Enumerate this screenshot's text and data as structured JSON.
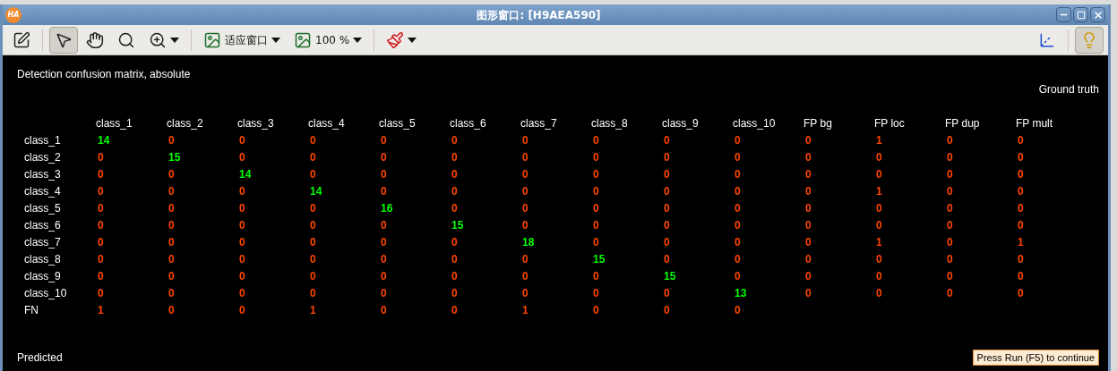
{
  "window": {
    "logo": "HA",
    "title": "图形窗口: [H9AEA590]"
  },
  "toolbar": [
    {
      "kind": "edit",
      "selected": false
    },
    {
      "kind": "pointer",
      "selected": true
    },
    {
      "kind": "pan",
      "selected": false
    },
    {
      "kind": "magnify",
      "selected": false
    },
    {
      "kind": "zoom",
      "selected": false,
      "menu": true
    },
    {
      "kind": "fit",
      "selected": false,
      "menu": true,
      "label": "适应窗口"
    },
    {
      "kind": "scale",
      "selected": false,
      "menu": true,
      "label": "100 %"
    },
    {
      "kind": "paint",
      "selected": false,
      "menu": true
    },
    {
      "kind": "axes",
      "selected": false
    },
    {
      "kind": "light",
      "selected": true
    }
  ],
  "canvas": {
    "title": "Detection confusion matrix, absolute",
    "column_axis": "Ground truth",
    "row_axis": "Predicted",
    "prompt": "Press Run (F5) to continue",
    "columns": [
      "class_1",
      "class_2",
      "class_3",
      "class_4",
      "class_5",
      "class_6",
      "class_7",
      "class_8",
      "class_9",
      "class_10",
      "FP bg",
      "FP loc",
      "FP dup",
      "FP mult"
    ],
    "rows": [
      {
        "label": "class_1",
        "cells": [
          {
            "value": "14",
            "color": "#00ff00"
          },
          {
            "value": "0",
            "color": "#ff4500"
          },
          {
            "value": "0",
            "color": "#ff4500"
          },
          {
            "value": "0",
            "color": "#ff4500"
          },
          {
            "value": "0",
            "color": "#ff4500"
          },
          {
            "value": "0",
            "color": "#ff4500"
          },
          {
            "value": "0",
            "color": "#ff4500"
          },
          {
            "value": "0",
            "color": "#ff4500"
          },
          {
            "value": "0",
            "color": "#ff4500"
          },
          {
            "value": "0",
            "color": "#ff4500"
          },
          {
            "value": "0",
            "color": "#ff4500"
          },
          {
            "value": "1",
            "color": "#ff4500"
          },
          {
            "value": "0",
            "color": "#ff4500"
          },
          {
            "value": "0",
            "color": "#ff4500"
          }
        ]
      },
      {
        "label": "class_2",
        "cells": [
          {
            "value": "0",
            "color": "#ff4500"
          },
          {
            "value": "15",
            "color": "#00ff00"
          },
          {
            "value": "0",
            "color": "#ff4500"
          },
          {
            "value": "0",
            "color": "#ff4500"
          },
          {
            "value": "0",
            "color": "#ff4500"
          },
          {
            "value": "0",
            "color": "#ff4500"
          },
          {
            "value": "0",
            "color": "#ff4500"
          },
          {
            "value": "0",
            "color": "#ff4500"
          },
          {
            "value": "0",
            "color": "#ff4500"
          },
          {
            "value": "0",
            "color": "#ff4500"
          },
          {
            "value": "0",
            "color": "#ff4500"
          },
          {
            "value": "0",
            "color": "#ff4500"
          },
          {
            "value": "0",
            "color": "#ff4500"
          },
          {
            "value": "0",
            "color": "#ff4500"
          }
        ]
      },
      {
        "label": "class_3",
        "cells": [
          {
            "value": "0",
            "color": "#ff4500"
          },
          {
            "value": "0",
            "color": "#ff4500"
          },
          {
            "value": "14",
            "color": "#00ff00"
          },
          {
            "value": "0",
            "color": "#ff4500"
          },
          {
            "value": "0",
            "color": "#ff4500"
          },
          {
            "value": "0",
            "color": "#ff4500"
          },
          {
            "value": "0",
            "color": "#ff4500"
          },
          {
            "value": "0",
            "color": "#ff4500"
          },
          {
            "value": "0",
            "color": "#ff4500"
          },
          {
            "value": "0",
            "color": "#ff4500"
          },
          {
            "value": "0",
            "color": "#ff4500"
          },
          {
            "value": "0",
            "color": "#ff4500"
          },
          {
            "value": "0",
            "color": "#ff4500"
          },
          {
            "value": "0",
            "color": "#ff4500"
          }
        ]
      },
      {
        "label": "class_4",
        "cells": [
          {
            "value": "0",
            "color": "#ff4500"
          },
          {
            "value": "0",
            "color": "#ff4500"
          },
          {
            "value": "0",
            "color": "#ff4500"
          },
          {
            "value": "14",
            "color": "#00ff00"
          },
          {
            "value": "0",
            "color": "#ff4500"
          },
          {
            "value": "0",
            "color": "#ff4500"
          },
          {
            "value": "0",
            "color": "#ff4500"
          },
          {
            "value": "0",
            "color": "#ff4500"
          },
          {
            "value": "0",
            "color": "#ff4500"
          },
          {
            "value": "0",
            "color": "#ff4500"
          },
          {
            "value": "0",
            "color": "#ff4500"
          },
          {
            "value": "1",
            "color": "#ff4500"
          },
          {
            "value": "0",
            "color": "#ff4500"
          },
          {
            "value": "0",
            "color": "#ff4500"
          }
        ]
      },
      {
        "label": "class_5",
        "cells": [
          {
            "value": "0",
            "color": "#ff4500"
          },
          {
            "value": "0",
            "color": "#ff4500"
          },
          {
            "value": "0",
            "color": "#ff4500"
          },
          {
            "value": "0",
            "color": "#ff4500"
          },
          {
            "value": "16",
            "color": "#00ff00"
          },
          {
            "value": "0",
            "color": "#ff4500"
          },
          {
            "value": "0",
            "color": "#ff4500"
          },
          {
            "value": "0",
            "color": "#ff4500"
          },
          {
            "value": "0",
            "color": "#ff4500"
          },
          {
            "value": "0",
            "color": "#ff4500"
          },
          {
            "value": "0",
            "color": "#ff4500"
          },
          {
            "value": "0",
            "color": "#ff4500"
          },
          {
            "value": "0",
            "color": "#ff4500"
          },
          {
            "value": "0",
            "color": "#ff4500"
          }
        ]
      },
      {
        "label": "class_6",
        "cells": [
          {
            "value": "0",
            "color": "#ff4500"
          },
          {
            "value": "0",
            "color": "#ff4500"
          },
          {
            "value": "0",
            "color": "#ff4500"
          },
          {
            "value": "0",
            "color": "#ff4500"
          },
          {
            "value": "0",
            "color": "#ff4500"
          },
          {
            "value": "15",
            "color": "#00ff00"
          },
          {
            "value": "0",
            "color": "#ff4500"
          },
          {
            "value": "0",
            "color": "#ff4500"
          },
          {
            "value": "0",
            "color": "#ff4500"
          },
          {
            "value": "0",
            "color": "#ff4500"
          },
          {
            "value": "0",
            "color": "#ff4500"
          },
          {
            "value": "0",
            "color": "#ff4500"
          },
          {
            "value": "0",
            "color": "#ff4500"
          },
          {
            "value": "0",
            "color": "#ff4500"
          }
        ]
      },
      {
        "label": "class_7",
        "cells": [
          {
            "value": "0",
            "color": "#ff4500"
          },
          {
            "value": "0",
            "color": "#ff4500"
          },
          {
            "value": "0",
            "color": "#ff4500"
          },
          {
            "value": "0",
            "color": "#ff4500"
          },
          {
            "value": "0",
            "color": "#ff4500"
          },
          {
            "value": "0",
            "color": "#ff4500"
          },
          {
            "value": "18",
            "color": "#00ff00"
          },
          {
            "value": "0",
            "color": "#ff4500"
          },
          {
            "value": "0",
            "color": "#ff4500"
          },
          {
            "value": "0",
            "color": "#ff4500"
          },
          {
            "value": "0",
            "color": "#ff4500"
          },
          {
            "value": "1",
            "color": "#ff4500"
          },
          {
            "value": "0",
            "color": "#ff4500"
          },
          {
            "value": "1",
            "color": "#ff4500"
          }
        ]
      },
      {
        "label": "class_8",
        "cells": [
          {
            "value": "0",
            "color": "#ff4500"
          },
          {
            "value": "0",
            "color": "#ff4500"
          },
          {
            "value": "0",
            "color": "#ff4500"
          },
          {
            "value": "0",
            "color": "#ff4500"
          },
          {
            "value": "0",
            "color": "#ff4500"
          },
          {
            "value": "0",
            "color": "#ff4500"
          },
          {
            "value": "0",
            "color": "#ff4500"
          },
          {
            "value": "15",
            "color": "#00ff00"
          },
          {
            "value": "0",
            "color": "#ff4500"
          },
          {
            "value": "0",
            "color": "#ff4500"
          },
          {
            "value": "0",
            "color": "#ff4500"
          },
          {
            "value": "0",
            "color": "#ff4500"
          },
          {
            "value": "0",
            "color": "#ff4500"
          },
          {
            "value": "0",
            "color": "#ff4500"
          }
        ]
      },
      {
        "label": "class_9",
        "cells": [
          {
            "value": "0",
            "color": "#ff4500"
          },
          {
            "value": "0",
            "color": "#ff4500"
          },
          {
            "value": "0",
            "color": "#ff4500"
          },
          {
            "value": "0",
            "color": "#ff4500"
          },
          {
            "value": "0",
            "color": "#ff4500"
          },
          {
            "value": "0",
            "color": "#ff4500"
          },
          {
            "value": "0",
            "color": "#ff4500"
          },
          {
            "value": "0",
            "color": "#ff4500"
          },
          {
            "value": "15",
            "color": "#00ff00"
          },
          {
            "value": "0",
            "color": "#ff4500"
          },
          {
            "value": "0",
            "color": "#ff4500"
          },
          {
            "value": "0",
            "color": "#ff4500"
          },
          {
            "value": "0",
            "color": "#ff4500"
          },
          {
            "value": "0",
            "color": "#ff4500"
          }
        ]
      },
      {
        "label": "class_10",
        "cells": [
          {
            "value": "0",
            "color": "#ff4500"
          },
          {
            "value": "0",
            "color": "#ff4500"
          },
          {
            "value": "0",
            "color": "#ff4500"
          },
          {
            "value": "0",
            "color": "#ff4500"
          },
          {
            "value": "0",
            "color": "#ff4500"
          },
          {
            "value": "0",
            "color": "#ff4500"
          },
          {
            "value": "0",
            "color": "#ff4500"
          },
          {
            "value": "0",
            "color": "#ff4500"
          },
          {
            "value": "0",
            "color": "#ff4500"
          },
          {
            "value": "13",
            "color": "#00ff00"
          },
          {
            "value": "0",
            "color": "#ff4500"
          },
          {
            "value": "0",
            "color": "#ff4500"
          },
          {
            "value": "0",
            "color": "#ff4500"
          },
          {
            "value": "0",
            "color": "#ff4500"
          }
        ]
      },
      {
        "label": "FN",
        "cells": [
          {
            "value": "1",
            "color": "#ff4500"
          },
          {
            "value": "0",
            "color": "#ff4500"
          },
          {
            "value": "0",
            "color": "#ff4500"
          },
          {
            "value": "1",
            "color": "#ff4500"
          },
          {
            "value": "0",
            "color": "#ff4500"
          },
          {
            "value": "0",
            "color": "#ff4500"
          },
          {
            "value": "1",
            "color": "#ff4500"
          },
          {
            "value": "0",
            "color": "#ff4500"
          },
          {
            "value": "0",
            "color": "#ff4500"
          },
          {
            "value": "0",
            "color": "#ff4500"
          }
        ]
      }
    ]
  }
}
